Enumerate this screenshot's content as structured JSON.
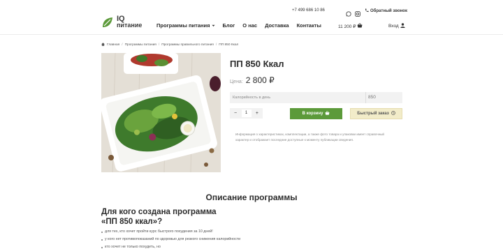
{
  "header": {
    "logo": {
      "line1": "IQ",
      "line2": "питание"
    },
    "phone": "+7 499 686 10 86",
    "callback_label": "Обратный звонок",
    "nav": [
      {
        "label": "Программы питания",
        "has_dropdown": true
      },
      {
        "label": "Блог"
      },
      {
        "label": "О нас"
      },
      {
        "label": "Доставка"
      },
      {
        "label": "Контакты"
      }
    ],
    "cart_total": "11 200 ₽",
    "login_label": "Вход",
    "icons": [
      "whatsapp-icon",
      "instagram-icon",
      "phone-icon",
      "basket-icon",
      "user-icon"
    ]
  },
  "breadcrumb": [
    "Главная",
    "Программы питания",
    "Программы правильного питания",
    "ПП 850 Ккал"
  ],
  "product": {
    "title": "ПП 850 Ккал",
    "price_label": "Цена:",
    "price": "2 800 ₽",
    "calories_label": "Калорийность в день",
    "calories_value": "850",
    "quantity": "1",
    "minus": "−",
    "plus": "+",
    "add_to_cart": "В корзину",
    "quick_order": "Быстрый заказ",
    "info": "Информация о характеристиках, комплектации, а также фото товара и упаковки имеет справочный характер и отображает последние доступные к моменту публикации сведения."
  },
  "description": {
    "section_title": "Описание программы",
    "heading_line1": "Для кого создана программа",
    "heading_line2": "«ПП 850 ккал»?",
    "bullets": [
      "для тех, кто хочет пройти курс быстрого похудения за 10 дней!",
      "у кого нет противопоказаний по здоровью для резкого снижения калорийности",
      "кто хочет не только похудеть, но"
    ]
  },
  "colors": {
    "accent_green": "#5c9a3a",
    "quick_order_bg": "#f2ecc9",
    "text_dark": "#2b2b2b"
  }
}
